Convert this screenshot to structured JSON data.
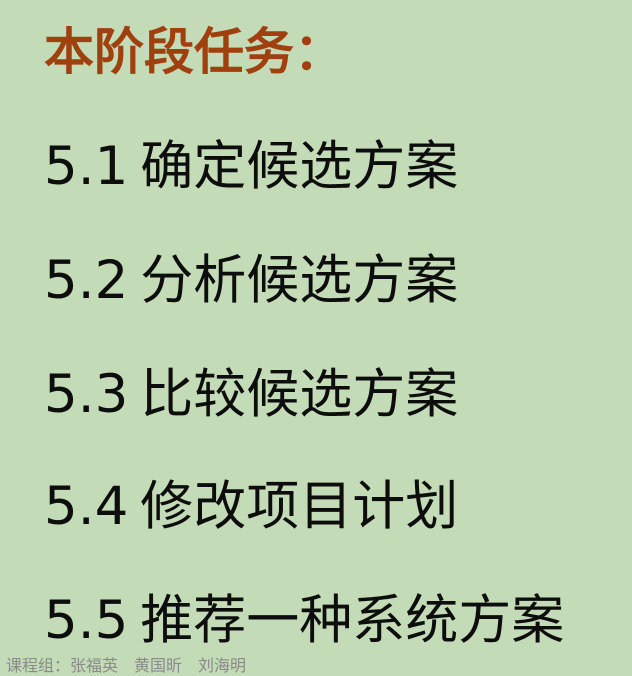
{
  "heading": "本阶段任务：",
  "tasks": [
    {
      "number": "5.1",
      "text": "确定候选方案"
    },
    {
      "number": "5.2",
      "text": "分析候选方案"
    },
    {
      "number": "5.3",
      "text": "比较候选方案"
    },
    {
      "number": "5.4",
      "text": "修改项目计划"
    },
    {
      "number": "5.5",
      "text": "推荐一种系统方案"
    }
  ],
  "footer": "课程组：张福英　黄国昕　刘海明"
}
